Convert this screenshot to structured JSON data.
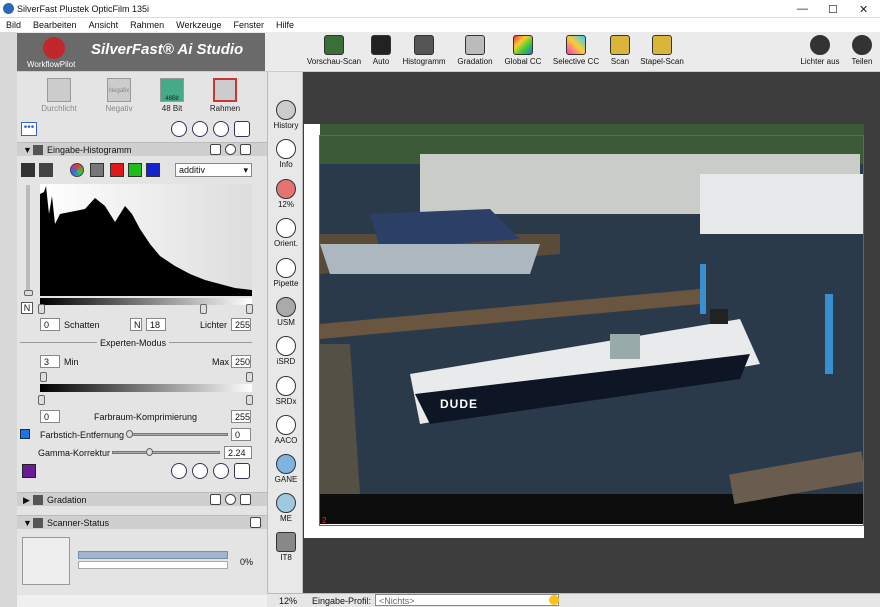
{
  "window": {
    "title": "SilverFast  Plustek OpticFilm 135i",
    "min": "—",
    "max": "☐",
    "close": "✕"
  },
  "menu": [
    "Bild",
    "Bearbeiten",
    "Ansicht",
    "Rahmen",
    "Werkzeuge",
    "Fenster",
    "Hilfe"
  ],
  "logo": {
    "workflow_pilot": "WorkflowPilot",
    "app_name": "SilverFast® Ai Studio"
  },
  "toolbar": {
    "items": [
      {
        "label": "Vorschau-Scan",
        "icon": "preview-scan-icon"
      },
      {
        "label": "Auto",
        "icon": "auto-icon"
      },
      {
        "label": "Histogramm",
        "icon": "histogram-icon"
      },
      {
        "label": "Gradation",
        "icon": "gradation-icon"
      },
      {
        "label": "Global CC",
        "icon": "global-cc-icon"
      },
      {
        "label": "Selective CC",
        "icon": "selective-cc-icon"
      },
      {
        "label": "Scan",
        "icon": "scan-icon"
      },
      {
        "label": "Stapel-Scan",
        "icon": "batch-scan-icon"
      }
    ],
    "right": [
      {
        "label": "Lichter aus",
        "icon": "lights-off-icon"
      },
      {
        "label": "Teilen",
        "icon": "share-icon"
      }
    ]
  },
  "panel_tabs": [
    {
      "label": "Durchlicht"
    },
    {
      "label": "Negativ",
      "badge": "Negafix"
    },
    {
      "label": "48 Bit",
      "badge": "48Bit"
    },
    {
      "label": "Rahmen"
    }
  ],
  "histogram": {
    "title": "Eingabe-Histogramm",
    "mode": "additiv",
    "mode_arrow": "▾",
    "n_label": "N",
    "shadows_value": "0",
    "shadows_label": "Schatten",
    "mid_label": "N",
    "mid_value": "18",
    "highlights_label": "Lichter",
    "highlights_value": "255",
    "expert_label": "Experten-Modus",
    "min_value": "3",
    "min_label": "Min",
    "max_label": "Max",
    "max_value": "250",
    "compress_value": "0",
    "compress_label": "Farbraum-Komprimierung",
    "compress_max": "255",
    "cast_label": "Farbstich-Entfernung",
    "cast_value": "0",
    "gamma_label": "Gamma-Korrektur",
    "gamma_value": "2.24"
  },
  "sections": {
    "gradation": "Gradation",
    "scanner_status": "Scanner-Status",
    "progress": "0%"
  },
  "sidebar": [
    {
      "label": "History",
      "icon": "history-icon"
    },
    {
      "label": "Info",
      "icon": "info-icon"
    },
    {
      "label": "12%",
      "icon": "zoom-icon"
    },
    {
      "label": "Orient.",
      "icon": "orientation-icon"
    },
    {
      "label": "Pipette",
      "icon": "pipette-icon"
    },
    {
      "label": "USM",
      "icon": "usm-icon"
    },
    {
      "label": "iSRD",
      "icon": "isrd-icon"
    },
    {
      "label": "SRDx",
      "icon": "srdx-icon"
    },
    {
      "label": "AACO",
      "icon": "aaco-icon"
    },
    {
      "label": "GANE",
      "icon": "gane-icon"
    },
    {
      "label": "ME",
      "icon": "me-icon"
    },
    {
      "label": "IT8",
      "icon": "it8-icon"
    }
  ],
  "photo": {
    "boat_name": "DUDE",
    "frame_number": "2"
  },
  "status": {
    "zoom": "12%",
    "profile_label": "Eingabe-Profil:",
    "profile_value": "<Nichts>"
  }
}
